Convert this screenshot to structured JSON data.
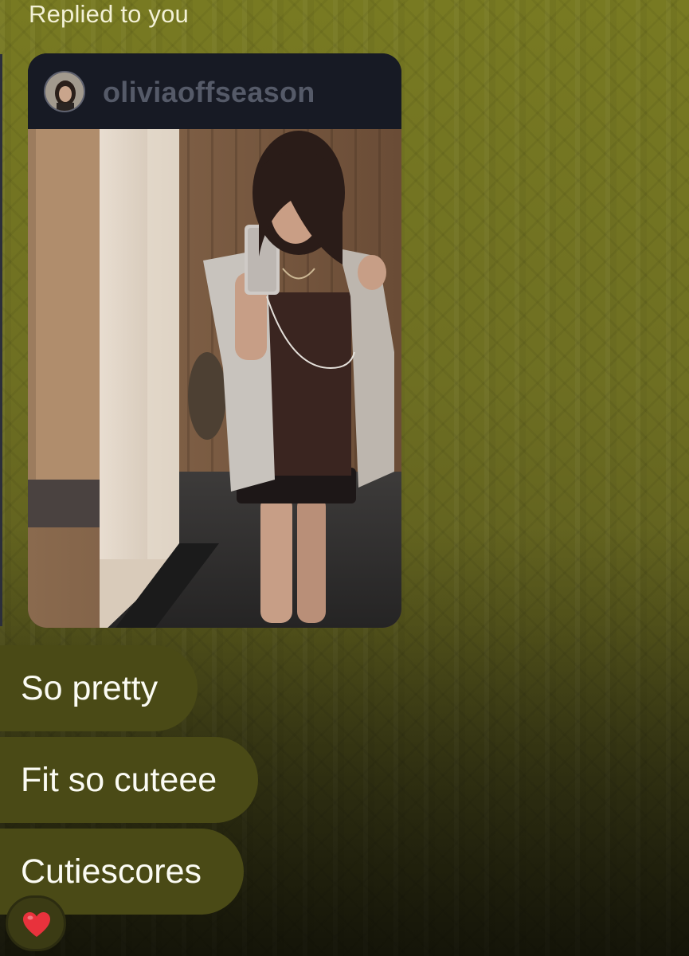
{
  "message": {
    "reply_caption": "Replied to you",
    "story": {
      "username": "oliviaoffseason"
    },
    "replies": [
      {
        "text": "So pretty"
      },
      {
        "text": "Fit so cuteee"
      },
      {
        "text": "Cutiescores"
      }
    ],
    "reaction": {
      "icon": "red-heart-icon",
      "color": "#e8323c"
    }
  },
  "colors": {
    "background": "#6e6f22",
    "bubble": "#4a4a16",
    "story_header": "#171a24",
    "username": "#555a68"
  }
}
